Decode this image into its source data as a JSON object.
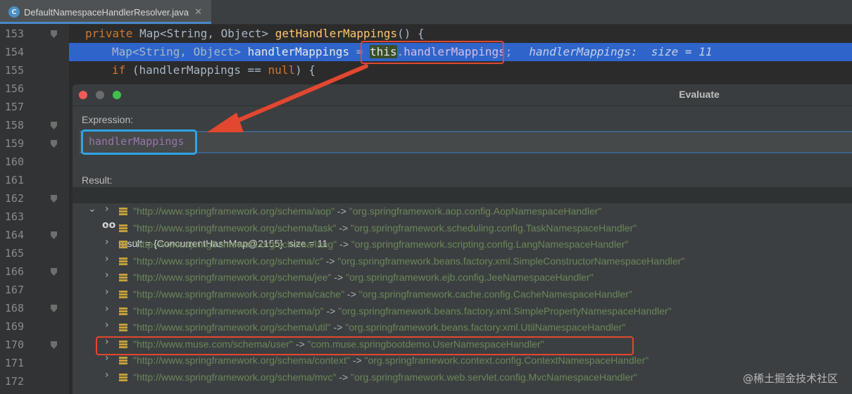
{
  "tab": {
    "icon_letter": "C",
    "title": "DefaultNamespaceHandlerResolver.java",
    "close": "✕"
  },
  "gutter": {
    "lines": [
      "153",
      "154",
      "155",
      "156",
      "157",
      "158",
      "159",
      "160",
      "161",
      "162",
      "163",
      "164",
      "165",
      "166",
      "167",
      "168",
      "169",
      "170",
      "171",
      "172"
    ]
  },
  "code": {
    "line153": {
      "kw": "private",
      "type": " Map<String, Object> ",
      "fn": "getHandlerMappings",
      "rest": "() {"
    },
    "line154": {
      "type": "Map<String, Object> ",
      "var": "handlerMappings",
      "eq": " = ",
      "this_kw": "this",
      "dot": ".",
      "field": "handlerMappings",
      "semi": ";",
      "hint": "handlerMappings:  size = 11"
    },
    "line155": {
      "kw": "if",
      "rest": " (handlerMappings == ",
      "null_kw": "null",
      "end": ") {"
    }
  },
  "dialog": {
    "title": "Evaluate",
    "expression_label": "Expression:",
    "expression_value": "handlerMappings",
    "result_label": "Result:",
    "root_symbol": "oo",
    "root_text": "result = {ConcurrentHashMap@2155}  size = 11",
    "entries": [
      {
        "key": "\"http://www.springframework.org/schema/aop\"",
        "value": "\"org.springframework.aop.config.AopNamespaceHandler\""
      },
      {
        "key": "\"http://www.springframework.org/schema/task\"",
        "value": "\"org.springframework.scheduling.config.TaskNamespaceHandler\""
      },
      {
        "key": "\"http://www.springframework.org/schema/lang\"",
        "value": "\"org.springframework.scripting.config.LangNamespaceHandler\""
      },
      {
        "key": "\"http://www.springframework.org/schema/c\"",
        "value": "\"org.springframework.beans.factory.xml.SimpleConstructorNamespaceHandler\""
      },
      {
        "key": "\"http://www.springframework.org/schema/jee\"",
        "value": "\"org.springframework.ejb.config.JeeNamespaceHandler\""
      },
      {
        "key": "\"http://www.springframework.org/schema/cache\"",
        "value": "\"org.springframework.cache.config.CacheNamespaceHandler\""
      },
      {
        "key": "\"http://www.springframework.org/schema/p\"",
        "value": "\"org.springframework.beans.factory.xml.SimplePropertyNamespaceHandler\""
      },
      {
        "key": "\"http://www.springframework.org/schema/util\"",
        "value": "\"org.springframework.beans.factory.xml.UtilNamespaceHandler\""
      },
      {
        "key": "\"http://www.muse.com/schema/user\"",
        "value": "\"com.muse.springbootdemo.UserNamespaceHandler\""
      },
      {
        "key": "\"http://www.springframework.org/schema/context\"",
        "value": "\"org.springframework.context.config.ContextNamespaceHandler\""
      },
      {
        "key": "\"http://www.springframework.org/schema/mvc\"",
        "value": "\"org.springframework.web.servlet.config.MvcNamespaceHandler\""
      }
    ],
    "arrow_text": " -> "
  },
  "colors": {
    "annotation_red": "#e2472f",
    "annotation_blue": "#2fa4e7",
    "selection": "#2f65ca"
  },
  "watermark": "@稀土掘金技术社区"
}
